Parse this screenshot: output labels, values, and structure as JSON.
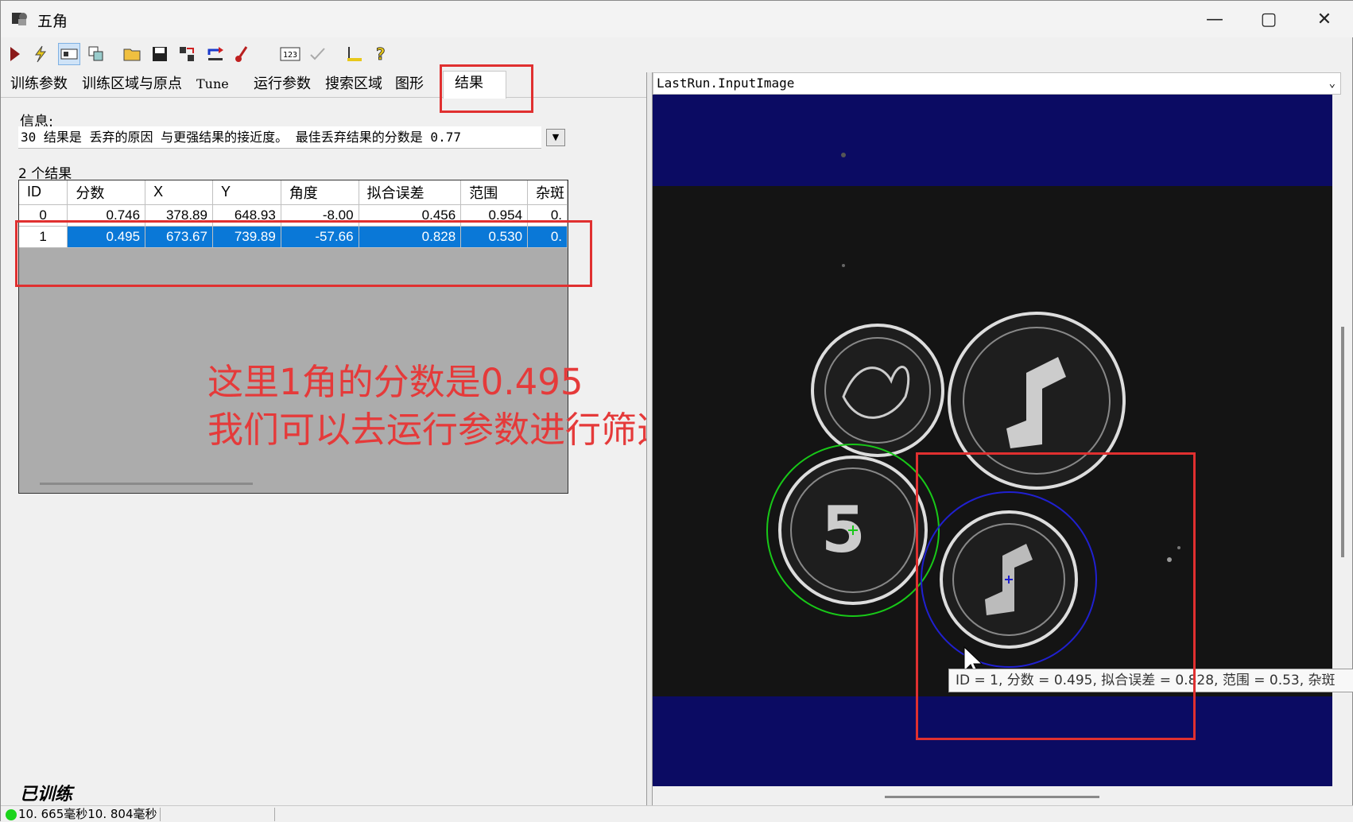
{
  "window": {
    "title": "五角"
  },
  "tabs": [
    {
      "label": "训练参数"
    },
    {
      "label": "训练区域与原点"
    },
    {
      "label": "Tune"
    },
    {
      "label": "运行参数"
    },
    {
      "label": "搜索区域"
    },
    {
      "label": "图形"
    },
    {
      "label": "结果"
    }
  ],
  "info": {
    "label": "信息:",
    "text": "30 结果是 丢弃的原因 与更强结果的接近度。  最佳丢弃结果的分数是 0.77"
  },
  "results": {
    "count_label": "2 个结果",
    "columns": [
      "ID",
      "分数",
      "X",
      "Y",
      "角度",
      "拟合误差",
      "范围",
      "杂斑"
    ],
    "rows": [
      {
        "id": "0",
        "score": "0.746",
        "x": "378.89",
        "y": "648.93",
        "angle": "-8.00",
        "fit": "0.456",
        "coverage": "0.954",
        "clutter": "0."
      },
      {
        "id": "1",
        "score": "0.495",
        "x": "673.67",
        "y": "739.89",
        "angle": "-57.66",
        "fit": "0.828",
        "coverage": "0.530",
        "clutter": "0."
      }
    ]
  },
  "annotation": {
    "line1": "这里1角的分数是0.495",
    "line2": "我们可以去运行参数进行筛选"
  },
  "trained_label": "已训练",
  "status": {
    "text": "10. 665毫秒10. 804毫秒"
  },
  "image_panel": {
    "source": "LastRun.InputImage"
  },
  "tooltip": {
    "text": "ID = 1, 分数 = 0.495, 拟合误差 = 0.828, 范围 = 0.53, 杂斑"
  },
  "colors": {
    "accent": "#0a78d7",
    "annotation_red": "#e53a3a",
    "image_bg": "#0b0b63"
  }
}
